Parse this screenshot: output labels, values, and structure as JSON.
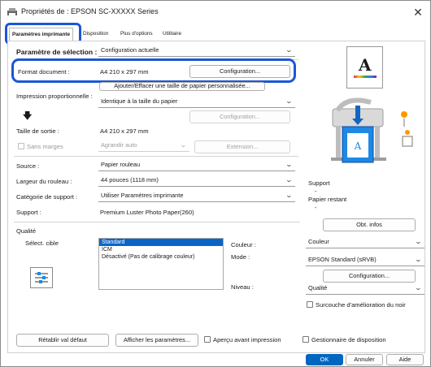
{
  "window": {
    "title": "Propriétés de : EPSON SC-XXXXX Series",
    "close_symbol": "✕"
  },
  "tabs": [
    {
      "label": "Paramètres imprimante"
    },
    {
      "label": "Disposition"
    },
    {
      "label": "Plus d'options"
    },
    {
      "label": "Utilitaire"
    }
  ],
  "selection": {
    "label": "Paramètre de sélection :",
    "value": "Configuration actuelle"
  },
  "format": {
    "label": "Format document :",
    "value": "A4 210 x 297 mm",
    "config_button": "Configuration...",
    "add_remove_button": "Ajouter/Effacer une taille de papier personnalisée..."
  },
  "proportional": {
    "label": "Impression proportionnelle :",
    "value": "Identique à la taille du papier",
    "config_button": "Configuration..."
  },
  "output": {
    "label": "Taille de sortie :",
    "value": "A4 210 x 297 mm",
    "arrow": "🡇"
  },
  "margins": {
    "checkbox_label": "Sans marges",
    "enlarge_value": "Agrandir auto",
    "extension_button": "Extension..."
  },
  "source": {
    "label": "Source :",
    "value": "Papier rouleau"
  },
  "roll_width": {
    "label": "Largeur du rouleau :",
    "value": "44 pouces (1118 mm)"
  },
  "media_category": {
    "label": "Catégorie de support :",
    "value": "Utiliser Paramètres imprimante"
  },
  "media": {
    "label": "Support :",
    "value": "Premium Luster Photo Paper(260)"
  },
  "status": {
    "support_label": "Support",
    "support_value": "-",
    "paper_remaining_label": "Papier restant",
    "paper_remaining_value": "-",
    "get_info_button": "Obt. infos"
  },
  "preview": {
    "letter": "A"
  },
  "quality": {
    "section_label": "Qualité",
    "select_target_label": "Sélect. cible",
    "list_items": [
      "Standard",
      "ICM",
      "Désactivé (Pas de calibrage couleur)"
    ],
    "selected_index": 0,
    "color_label": "Couleur :",
    "color_value": "Couleur",
    "mode_label": "Mode :",
    "mode_value": "EPSON Standard (sRVB)",
    "config_button": "Configuration...",
    "level_label": "Niveau :",
    "level_value": "Qualité",
    "black_enhance_label": "Surcouche d'amélioration du noir"
  },
  "footer": {
    "reset_button": "Rétablir val défaut",
    "show_settings_button": "Afficher les paramètres...",
    "preview_checkbox": "Aperçu avant impression",
    "layout_manager_checkbox": "Gestionnaire de disposition",
    "ok_button": "OK",
    "cancel_button": "Annuler",
    "help_button": "Aide"
  },
  "colors": {
    "highlight": "#1b57d6",
    "selection": "#0a64c8",
    "ok_button": "#0067c0",
    "printer_accent": "#1e88e5"
  }
}
